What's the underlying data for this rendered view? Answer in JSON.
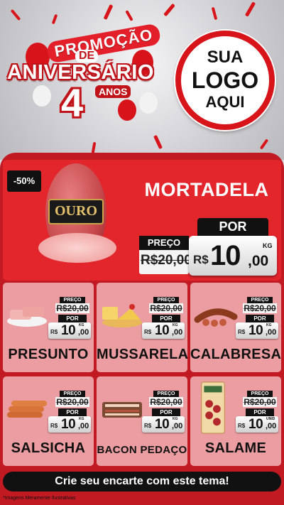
{
  "header": {
    "promo_word": "PROMOÇÃO",
    "de_word": "DE",
    "aniversario_word": "ANIVERSÁRIO",
    "number": "4",
    "anos_word": "ANOS",
    "logo_lines": [
      "SUA",
      "LOGO",
      "AQUI"
    ]
  },
  "featured": {
    "badge": "-50%",
    "name": "MORTADELA",
    "brand_label": "OURO",
    "preco_label": "PREÇO",
    "old_price": "R$20,00",
    "por_label": "POR",
    "currency": "R$",
    "price_int": "10",
    "price_dec": ",00",
    "unit": "KG"
  },
  "products": [
    {
      "name": "PRESUNTO",
      "preco_label": "PREÇO",
      "old_price": "R$20,00",
      "por_label": "POR",
      "currency": "R$",
      "price_int": "10",
      "price_dec": ",00",
      "unit": "KG"
    },
    {
      "name": "MUSSARELA",
      "preco_label": "PREÇO",
      "old_price": "R$20,00",
      "por_label": "POR",
      "currency": "R$",
      "price_int": "10",
      "price_dec": ",00",
      "unit": "KG"
    },
    {
      "name": "CALABRESA",
      "preco_label": "PREÇO",
      "old_price": "R$20,00",
      "por_label": "POR",
      "currency": "R$",
      "price_int": "10",
      "price_dec": ",00",
      "unit": "KG"
    },
    {
      "name": "SALSICHA",
      "preco_label": "PREÇO",
      "old_price": "R$20,00",
      "por_label": "POR",
      "currency": "R$",
      "price_int": "10",
      "price_dec": ",00",
      "unit": "KG"
    },
    {
      "name": "BACON PEDAÇO",
      "preco_label": "PREÇO",
      "old_price": "R$20,00",
      "por_label": "POR",
      "currency": "R$",
      "price_int": "10",
      "price_dec": ",00",
      "unit": "KG"
    },
    {
      "name": "SALAME",
      "preco_label": "PREÇO",
      "old_price": "R$20,00",
      "por_label": "POR",
      "currency": "R$",
      "price_int": "10",
      "price_dec": ",00",
      "unit": "UNID"
    }
  ],
  "cta": "Crie seu encarte com este tema!",
  "disclaimer": "*Imagens Meramente Ilustrativas",
  "colors": {
    "primary_red": "#c21a22",
    "bright_red": "#e3252c",
    "card_pink": "#eb9da1",
    "black": "#111111"
  }
}
